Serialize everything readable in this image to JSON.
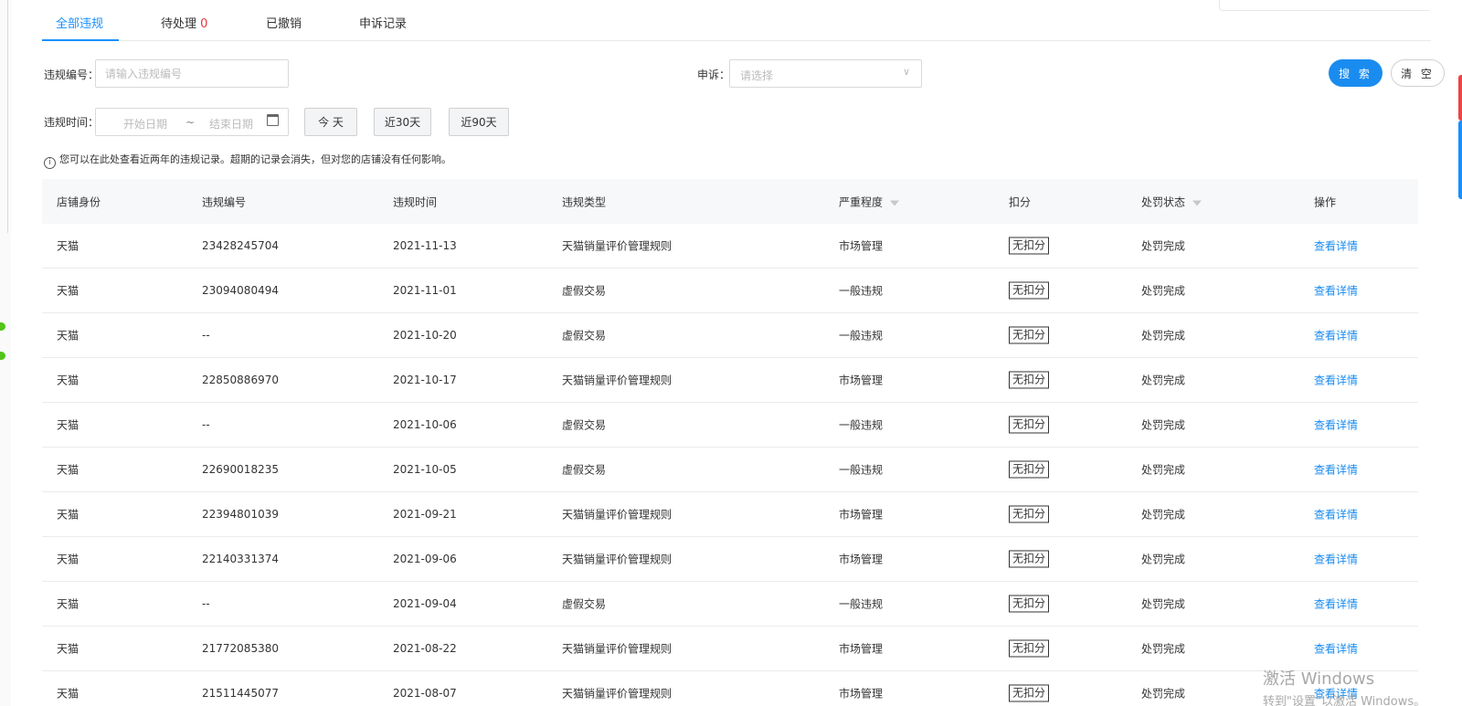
{
  "tabs": [
    {
      "label": "全部违规",
      "count": "",
      "active": true
    },
    {
      "label": "待处理",
      "count": "0",
      "active": false
    },
    {
      "label": "已撤销",
      "count": "",
      "active": false
    },
    {
      "label": "申诉记录",
      "count": "",
      "active": false
    }
  ],
  "filters": {
    "violation_id_label": "违规编号：",
    "violation_id_placeholder": "请输入违规编号",
    "appeal_label": "申诉：",
    "appeal_placeholder": "请选择",
    "time_label": "违规时间：",
    "start_placeholder": "开始日期",
    "range_sep": "~",
    "end_placeholder": "结束日期",
    "quick_today": "今 天",
    "quick_30": "近30天",
    "quick_90": "近90天",
    "search_label": "搜 索",
    "clear_label": "清 空"
  },
  "tip_text": "您可以在此处查看近两年的违规记录。超期的记录会消失，但对您的店铺没有任何影响。",
  "table": {
    "columns": [
      "店铺身份",
      "违规编号",
      "违规时间",
      "违规类型",
      "严重程度",
      "扣分",
      "处罚状态",
      "操作"
    ],
    "rows": [
      [
        "天猫",
        "23428245704",
        "2021-11-13",
        "天猫销量评价管理规则",
        "市场管理",
        "无扣分",
        "处罚完成",
        "查看详情"
      ],
      [
        "天猫",
        "23094080494",
        "2021-11-01",
        "虚假交易",
        "一般违规",
        "无扣分",
        "处罚完成",
        "查看详情"
      ],
      [
        "天猫",
        "--",
        "2021-10-20",
        "虚假交易",
        "一般违规",
        "无扣分",
        "处罚完成",
        "查看详情"
      ],
      [
        "天猫",
        "22850886970",
        "2021-10-17",
        "天猫销量评价管理规则",
        "市场管理",
        "无扣分",
        "处罚完成",
        "查看详情"
      ],
      [
        "天猫",
        "--",
        "2021-10-06",
        "虚假交易",
        "一般违规",
        "无扣分",
        "处罚完成",
        "查看详情"
      ],
      [
        "天猫",
        "22690018235",
        "2021-10-05",
        "虚假交易",
        "一般违规",
        "无扣分",
        "处罚完成",
        "查看详情"
      ],
      [
        "天猫",
        "22394801039",
        "2021-09-21",
        "天猫销量评价管理规则",
        "市场管理",
        "无扣分",
        "处罚完成",
        "查看详情"
      ],
      [
        "天猫",
        "22140331374",
        "2021-09-06",
        "天猫销量评价管理规则",
        "市场管理",
        "无扣分",
        "处罚完成",
        "查看详情"
      ],
      [
        "天猫",
        "--",
        "2021-09-04",
        "虚假交易",
        "一般违规",
        "无扣分",
        "处罚完成",
        "查看详情"
      ],
      [
        "天猫",
        "21772085380",
        "2021-08-22",
        "天猫销量评价管理规则",
        "市场管理",
        "无扣分",
        "处罚完成",
        "查看详情"
      ],
      [
        "天猫",
        "21511445077",
        "2021-08-07",
        "天猫销量评价管理规则",
        "市场管理",
        "无扣分",
        "处罚完成",
        "查看详情"
      ]
    ]
  },
  "watermark": {
    "line1": "激活 Windows",
    "line2": "转到\"设置\"以激活 Windows。"
  },
  "colors": {
    "accent": "#1a8cf0",
    "count_red": "#e4393c"
  }
}
